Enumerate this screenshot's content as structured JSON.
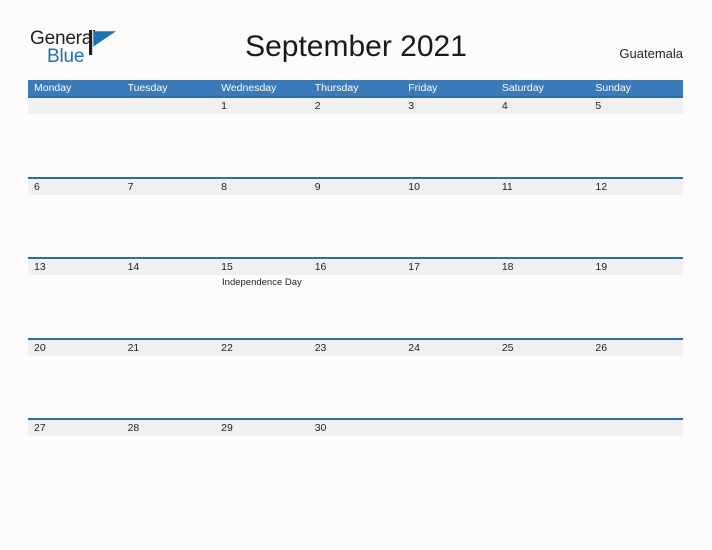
{
  "brand": {
    "name_part1": "General",
    "name_part2": "Blue",
    "flag_color": "#1f6fb5",
    "text_color": "#231f20"
  },
  "header": {
    "title": "September 2021",
    "region": "Guatemala"
  },
  "theme": {
    "header_bar_color": "#3a7ab8",
    "row_line_color": "#2e6da4",
    "date_band_color": "#f0f0f0",
    "page_background": "#fcfcfd"
  },
  "calendar": {
    "day_names": [
      "Monday",
      "Tuesday",
      "Wednesday",
      "Thursday",
      "Friday",
      "Saturday",
      "Sunday"
    ],
    "weeks": [
      [
        {
          "date": "",
          "events": []
        },
        {
          "date": "",
          "events": []
        },
        {
          "date": "1",
          "events": []
        },
        {
          "date": "2",
          "events": []
        },
        {
          "date": "3",
          "events": []
        },
        {
          "date": "4",
          "events": []
        },
        {
          "date": "5",
          "events": []
        }
      ],
      [
        {
          "date": "6",
          "events": []
        },
        {
          "date": "7",
          "events": []
        },
        {
          "date": "8",
          "events": []
        },
        {
          "date": "9",
          "events": []
        },
        {
          "date": "10",
          "events": []
        },
        {
          "date": "11",
          "events": []
        },
        {
          "date": "12",
          "events": []
        }
      ],
      [
        {
          "date": "13",
          "events": []
        },
        {
          "date": "14",
          "events": []
        },
        {
          "date": "15",
          "events": [
            "Independence Day"
          ]
        },
        {
          "date": "16",
          "events": []
        },
        {
          "date": "17",
          "events": []
        },
        {
          "date": "18",
          "events": []
        },
        {
          "date": "19",
          "events": []
        }
      ],
      [
        {
          "date": "20",
          "events": []
        },
        {
          "date": "21",
          "events": []
        },
        {
          "date": "22",
          "events": []
        },
        {
          "date": "23",
          "events": []
        },
        {
          "date": "24",
          "events": []
        },
        {
          "date": "25",
          "events": []
        },
        {
          "date": "26",
          "events": []
        }
      ],
      [
        {
          "date": "27",
          "events": []
        },
        {
          "date": "28",
          "events": []
        },
        {
          "date": "29",
          "events": []
        },
        {
          "date": "30",
          "events": []
        },
        {
          "date": "",
          "events": []
        },
        {
          "date": "",
          "events": []
        },
        {
          "date": "",
          "events": []
        }
      ]
    ]
  }
}
